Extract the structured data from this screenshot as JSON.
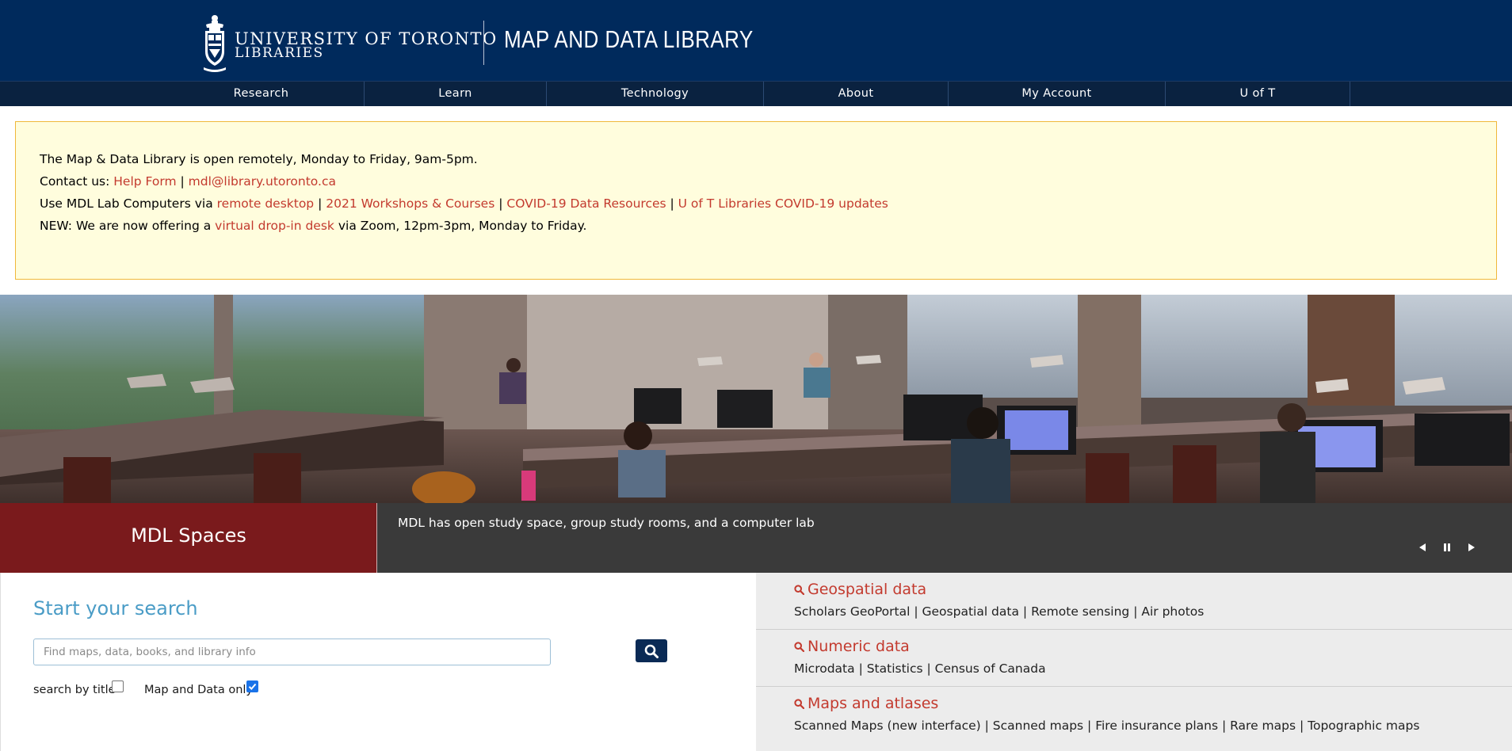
{
  "header": {
    "university_line1": "UNIVERSITY OF TORONTO",
    "university_line2": "LIBRARIES",
    "site_title": "MAP AND DATA LIBRARY"
  },
  "nav": {
    "items": [
      {
        "label": "Research"
      },
      {
        "label": "Learn"
      },
      {
        "label": "Technology"
      },
      {
        "label": "About"
      },
      {
        "label": "My Account"
      },
      {
        "label": "U of T"
      }
    ]
  },
  "notice": {
    "line1": "The Map & Data Library is open remotely, Monday to Friday, 9am-5pm.",
    "contact_prefix": "Contact us: ",
    "help_form": "Help Form",
    "sep": " | ",
    "email": "mdl@library.utoronto.ca",
    "lab_prefix": "Use MDL Lab Computers via ",
    "remote_desktop": "remote desktop",
    "workshops": "2021 Workshops & Courses",
    "covid_data": "COVID-19 Data Resources",
    "covid_updates": "U of T Libraries COVID-19 updates",
    "new_prefix": "NEW: We are now offering a ",
    "virtual_desk": "virtual drop-in desk",
    "new_suffix": " via Zoom, 12pm-3pm, Monday to Friday."
  },
  "slider": {
    "title": "MDL Spaces",
    "caption": "MDL has open study space, group study rooms, and a computer lab"
  },
  "search": {
    "heading": "Start your search",
    "placeholder": "Find maps, data, books, and library info",
    "value": "",
    "by_title_label": "search by title",
    "by_title_checked": false,
    "map_data_label": "Map and Data only",
    "map_data_checked": true
  },
  "quick_links": [
    {
      "title": "Geospatial data",
      "links": [
        "Scholars GeoPortal",
        "Geospatial data",
        "Remote sensing",
        "Air photos"
      ]
    },
    {
      "title": "Numeric data",
      "links": [
        "Microdata",
        "Statistics",
        "Census of Canada"
      ]
    },
    {
      "title": "Maps and atlases",
      "links": [
        "Scanned Maps (new interface)",
        "Scanned maps",
        "Fire insurance plans",
        "Rare maps",
        "Topographic maps"
      ]
    }
  ],
  "link_separator": " | ",
  "colors": {
    "header_blue": "#002a5c",
    "nav_blue": "#0a2240",
    "link_red": "#c33a2e",
    "heading_blue": "#4a9cc6",
    "caption_maroon": "#7a1a1c",
    "notice_bg": "#fffddd"
  },
  "icons": {
    "crest": "university-crest-icon",
    "search": "magnifier-icon",
    "prev": "triangle-left-icon",
    "pause": "pause-icon",
    "next": "triangle-right-icon"
  }
}
